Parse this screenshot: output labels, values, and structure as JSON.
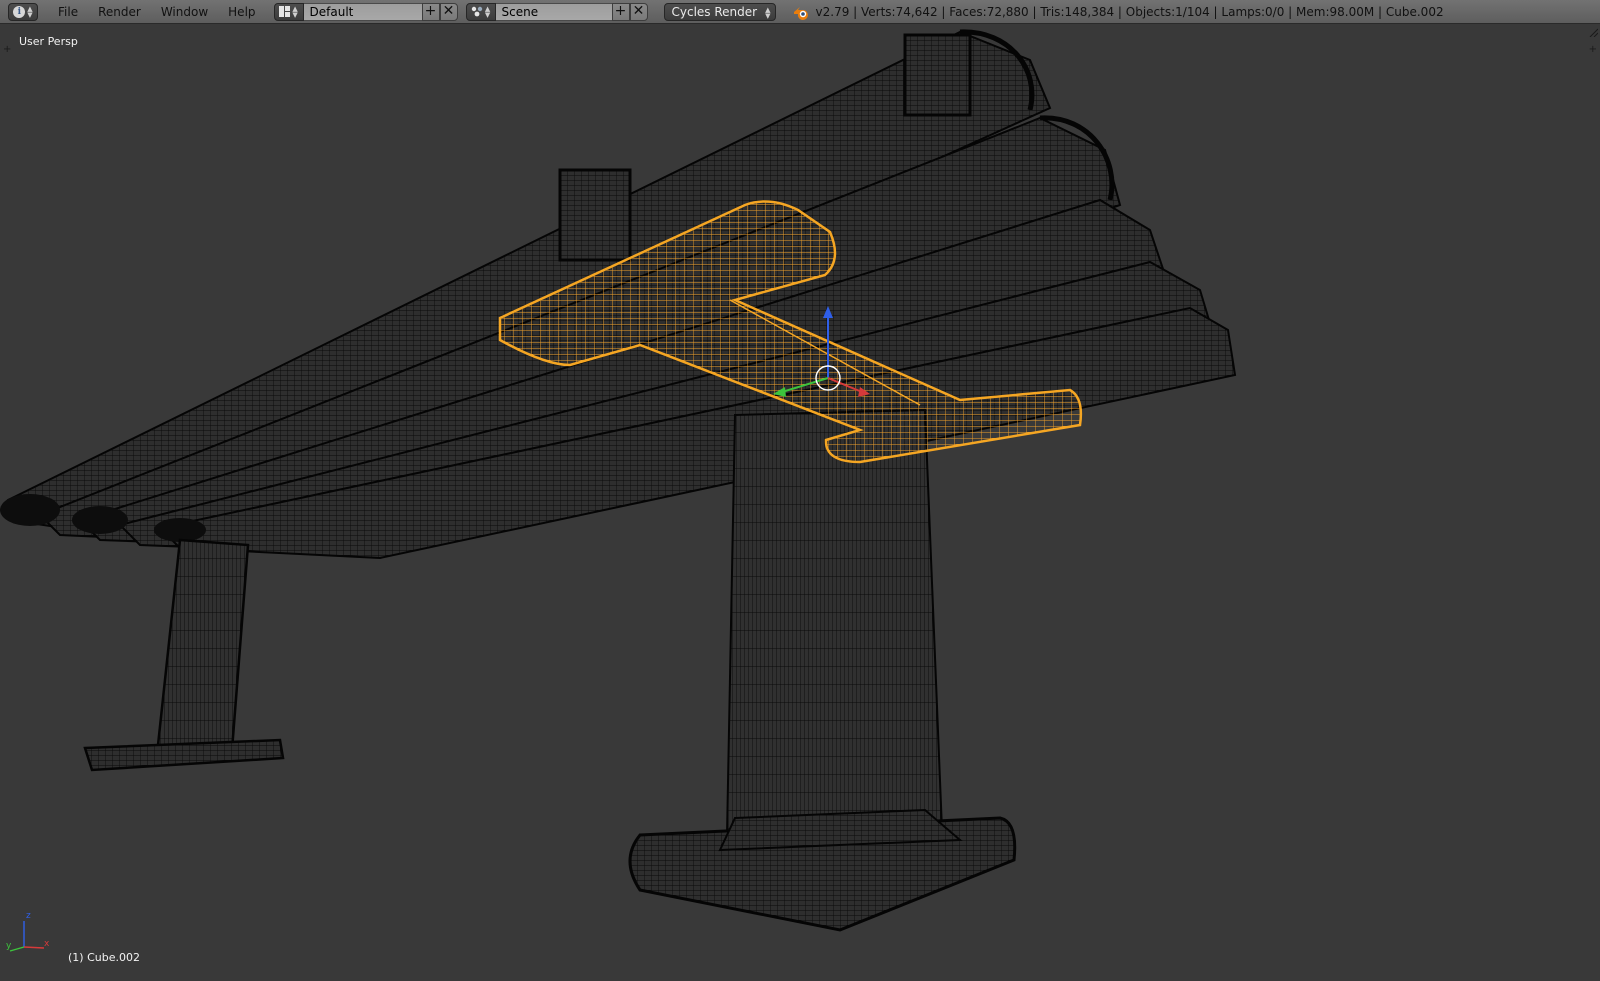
{
  "header": {
    "editor_type_icon": "info-icon",
    "menu": [
      "File",
      "Render",
      "Window",
      "Help"
    ],
    "screen_layout": {
      "icon": "screen-layout-icon",
      "value": "Default"
    },
    "scene": {
      "icon": "scene-icon",
      "value": "Scene"
    },
    "render_engine": "Cycles Render",
    "stats": "v2.79 | Verts:74,642 | Faces:72,880 | Tris:148,384 | Objects:1/104 | Lamps:0/0 | Mem:98.00M | Cube.002"
  },
  "viewport": {
    "view_name": "User Persp",
    "active_object_label": "(1) Cube.002",
    "gizmo_axes": [
      "x",
      "y",
      "z"
    ]
  },
  "colors": {
    "background": "#393939",
    "wireframe": "#0a0a0a",
    "selection": "#f5a623",
    "axis_x": "#d63a3a",
    "axis_y": "#3cc43c",
    "axis_z": "#2f5fe8"
  }
}
